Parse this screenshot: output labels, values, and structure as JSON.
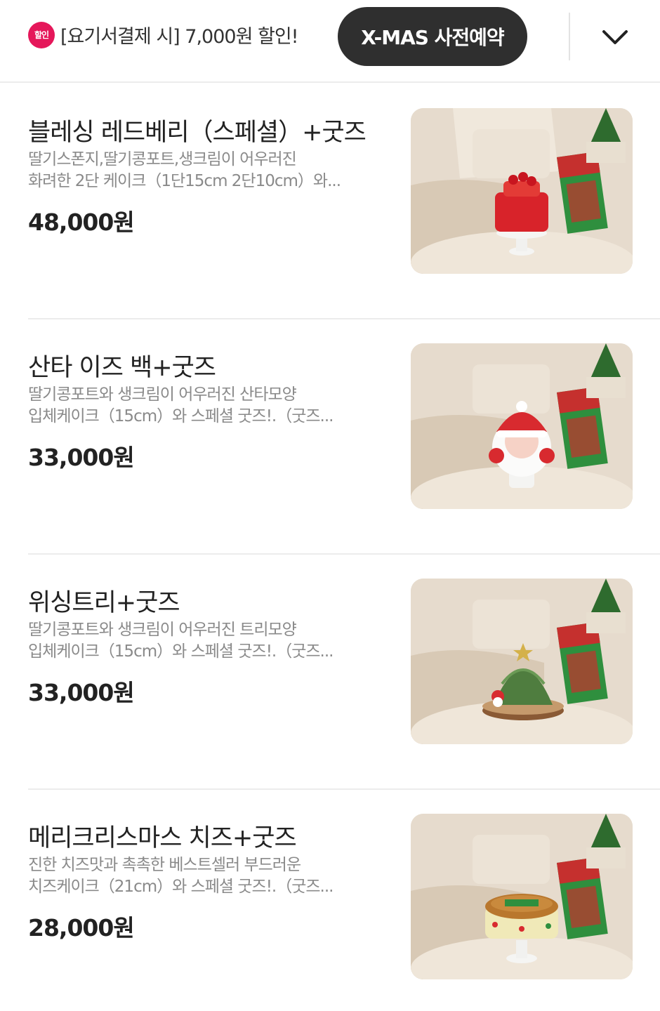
{
  "header": {
    "promo_badge": "할인",
    "promo_text": "[요기서결제 시] 7,000원 할인!",
    "category_button": "X-MAS 사전예약",
    "expand_icon": "chevron-down-icon"
  },
  "menu_items": [
    {
      "title": "블레싱 레드베리（스페셜）+굿즈",
      "desc_line1": "딸기스폰지,딸기콩포트,생크림이 어우러진",
      "desc_line2": "화려한 2단 케이크（1단15cm 2단10cm）와...",
      "price": "48,000원"
    },
    {
      "title": "산타 이즈 백+굿즈",
      "desc_line1": "딸기콩포트와 생크림이 어우러진 산타모양",
      "desc_line2": "입체케이크（15cm）와 스페셜 굿즈!.（굿즈...",
      "price": "33,000원"
    },
    {
      "title": "위싱트리+굿즈",
      "desc_line1": "딸기콩포트와 생크림이 어우러진 트리모양",
      "desc_line2": "입체케이크（15cm）와 스페셜 굿즈!.（굿즈...",
      "price": "33,000원"
    },
    {
      "title": "메리크리스마스 치즈+굿즈",
      "desc_line1": "진한 치즈맛과 촉촉한 베스트셀러 부드러운",
      "desc_line2": "치즈케이크（21cm）와 스페셜 굿즈!.（굿즈...",
      "price": "28,000원"
    }
  ],
  "colors": {
    "badge": "#e5175a",
    "button_bg": "#2f2f2f",
    "divider": "#ececec"
  }
}
